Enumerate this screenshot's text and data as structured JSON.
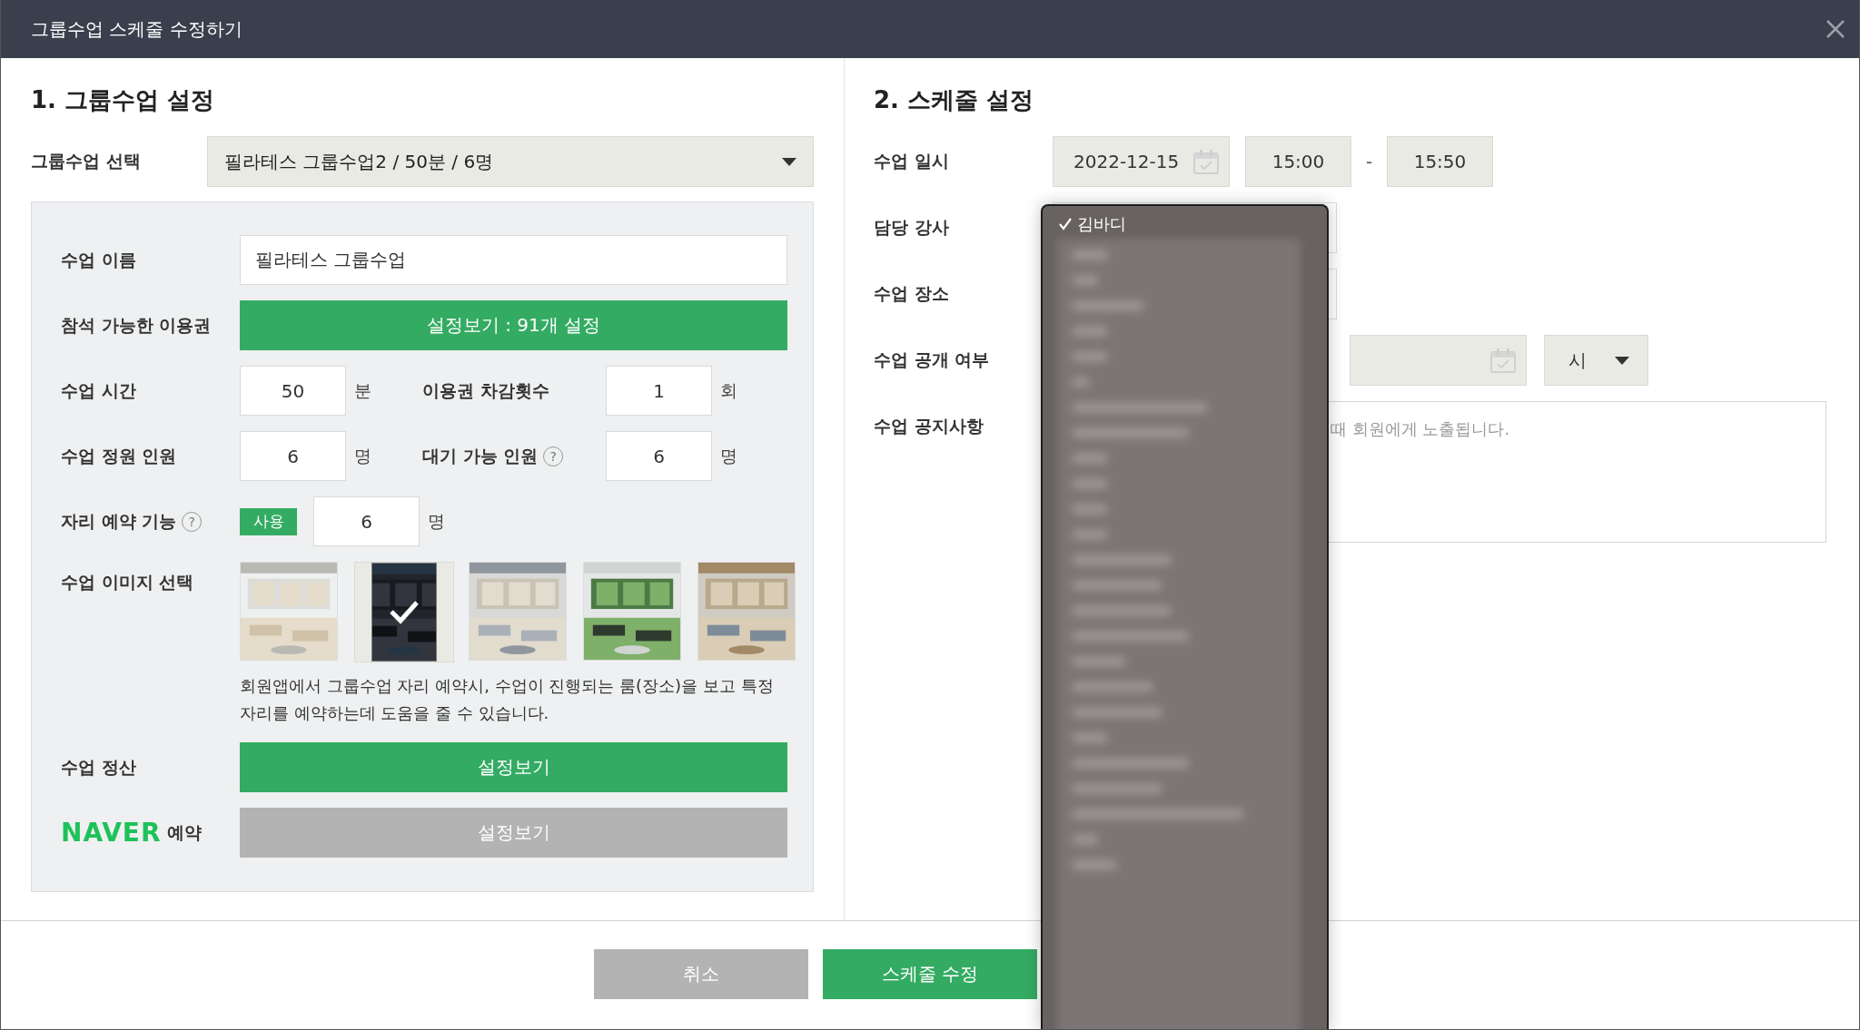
{
  "window": {
    "title": "그룹수업 스케줄 수정하기"
  },
  "group": {
    "heading": "1. 그룹수업 설정",
    "select_label": "그룹수업 선택",
    "select_value": "필라테스 그룹수업2 / 50분 / 6명",
    "name": {
      "label": "수업 이름",
      "value": "필라테스 그룹수업"
    },
    "passes": {
      "label": "참석 가능한 이용권",
      "button": "설정보기 : 91개 설정"
    },
    "pairs": [
      {
        "label": "수업 시간",
        "value": "50",
        "unit": "분",
        "label2": "이용권 차감횟수",
        "value2": "1",
        "unit2": "회"
      },
      {
        "label": "수업 정원 인원",
        "value": "6",
        "unit": "명",
        "label2": "대기 가능 인원",
        "help2": "?",
        "value2": "6",
        "unit2": "명"
      }
    ],
    "seat": {
      "label": "자리 예약 기능",
      "help": "?",
      "toggle": {
        "label": "사용",
        "on": true
      },
      "value": "6",
      "unit": "명"
    },
    "images": {
      "label": "수업 이미지 선택",
      "items": [
        {
          "kind": "picture",
          "selected": false
        },
        {
          "kind": "picture",
          "selected": true
        },
        {
          "kind": "picture",
          "selected": false
        },
        {
          "kind": "picture",
          "selected": false
        },
        {
          "kind": "picture",
          "selected": false
        }
      ],
      "note": "회원앱에서 그룹수업 자리 예약시, 수업이 진행되는 룸(장소)을 보고 특정 자리를 예약하는데 도움을 줄 수 있습니다."
    },
    "settings": [
      {
        "kind": "text",
        "label": "수업 정산",
        "button": "설정보기",
        "enabled": true
      },
      {
        "kind": "naver",
        "logo": "NAVER",
        "label": "예약",
        "button": "설정보기",
        "enabled": false
      }
    ]
  },
  "schedule": {
    "heading": "2. 스케줄 설정",
    "labels": [
      "수업 일시",
      "담당 강사",
      "수업 장소",
      "수업 공개 여부",
      "수업 공지사항"
    ],
    "date": "2022-12-15",
    "start": "15:00",
    "separator": "-",
    "end": "15:50",
    "open_hour": "시",
    "notice_placeholder": "때 회원에게 노출됩니다."
  },
  "instructor_dropdown": {
    "items": [
      {
        "label": "김바디",
        "selected": true
      }
    ]
  },
  "footer": {
    "buttons": [
      {
        "label": "취소",
        "kind": "secondary"
      },
      {
        "label": "스케줄 수정",
        "kind": "primary"
      }
    ]
  }
}
